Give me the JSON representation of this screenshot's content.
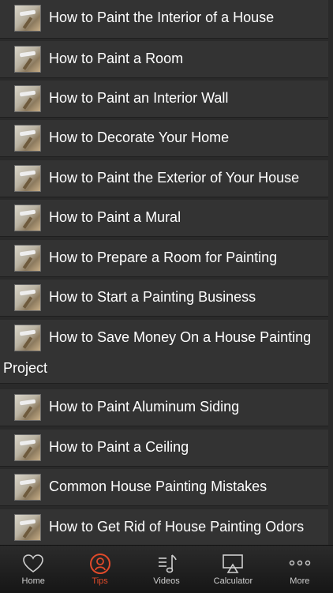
{
  "list": {
    "items": [
      {
        "label": "How to Paint the Interior of a House"
      },
      {
        "label": "How to Paint a Room"
      },
      {
        "label": "How to Paint an Interior Wall"
      },
      {
        "label": "How to Decorate Your Home"
      },
      {
        "label": "How to Paint the Exterior of Your House"
      },
      {
        "label": "How to Paint a Mural"
      },
      {
        "label": "How to Prepare a Room for Painting"
      },
      {
        "label": "How to Start a Painting Business"
      },
      {
        "label": "How to Save Money On a House Painting",
        "continuation": "Project"
      },
      {
        "label": "How to Paint Aluminum Siding"
      },
      {
        "label": "How to Paint a Ceiling"
      },
      {
        "label": "Common House Painting Mistakes"
      },
      {
        "label": "How to Get Rid of House Painting Odors"
      }
    ]
  },
  "tabbar": {
    "tabs": [
      {
        "label": "Home",
        "icon": "heart-icon"
      },
      {
        "label": "Tips",
        "icon": "person-icon",
        "active": true
      },
      {
        "label": "Videos",
        "icon": "music-note-icon"
      },
      {
        "label": "Calculator",
        "icon": "airplay-icon"
      },
      {
        "label": "More",
        "icon": "more-dots-icon"
      }
    ]
  },
  "colors": {
    "active_tab": "#e04a2a",
    "row_bg": "#333333",
    "page_bg": "#2a2a2a"
  }
}
